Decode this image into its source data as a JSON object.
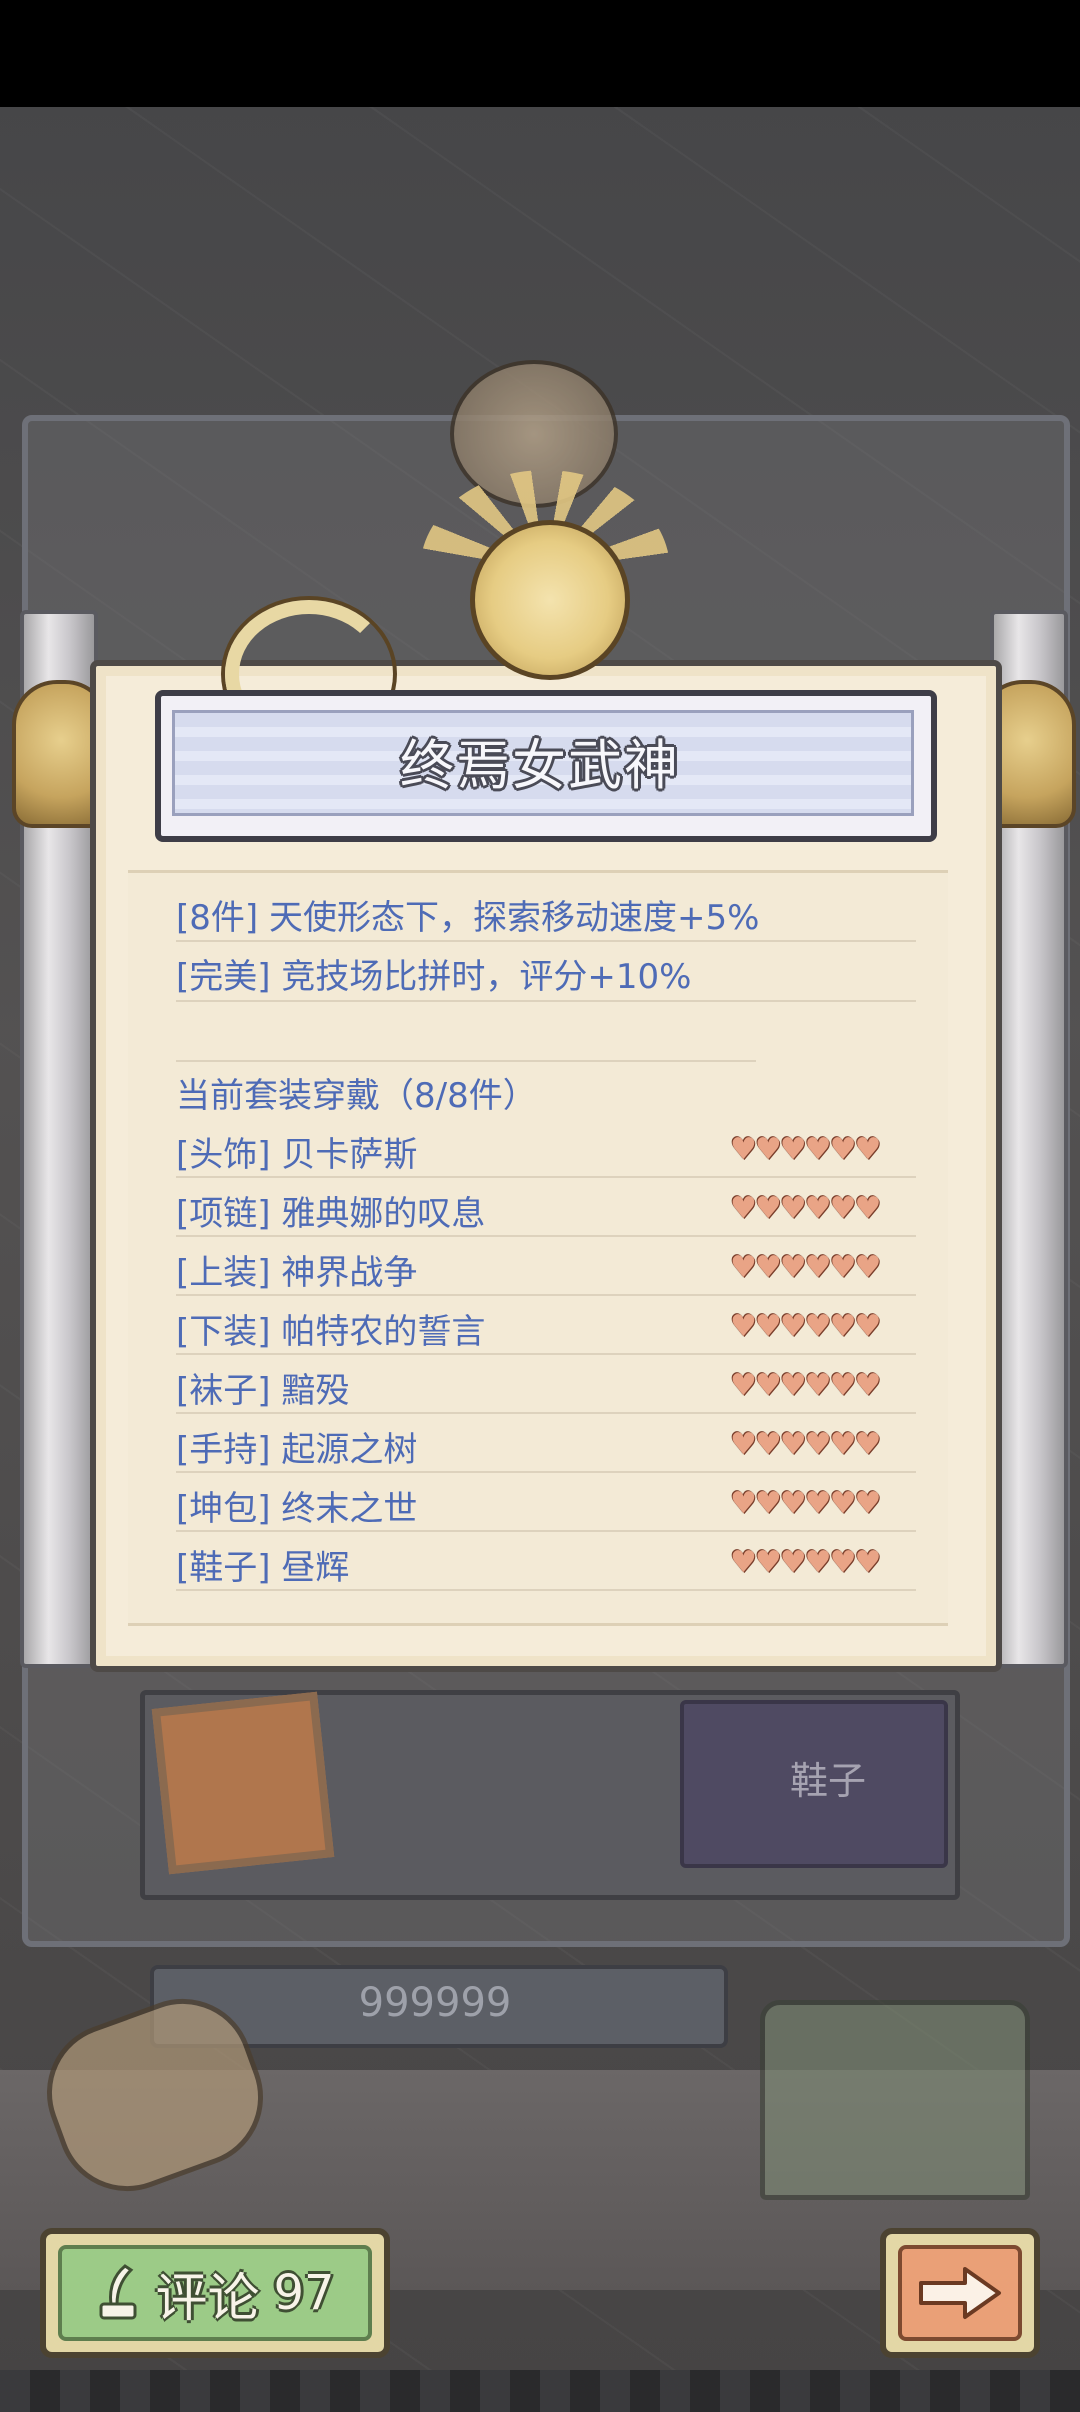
{
  "title": "终焉女武神",
  "bonuses": [
    {
      "label": "[8件]  天使形态下，探索移动速度+5%"
    },
    {
      "label": "[完美] 竞技场比拼时，评分+10%"
    }
  ],
  "set_header": "当前套装穿戴（8/8件）",
  "items": [
    {
      "label": "[头饰] 贝卡萨斯",
      "hearts": 6
    },
    {
      "label": "[项链] 雅典娜的叹息",
      "hearts": 6
    },
    {
      "label": "[上装] 神界战争",
      "hearts": 6
    },
    {
      "label": "[下装] 帕特农的誓言",
      "hearts": 6
    },
    {
      "label": "[袜子] 黯殁",
      "hearts": 6
    },
    {
      "label": "[手持] 起源之树",
      "hearts": 6
    },
    {
      "label": "[坤包] 终末之世",
      "hearts": 6
    },
    {
      "label": "[鞋子] 昼辉",
      "hearts": 6
    }
  ],
  "hearts_text": "♥♥♥♥♥♥",
  "slot_label": "鞋子",
  "counter_value": "999999",
  "comment": {
    "label": "评论",
    "count": "97"
  },
  "colors": {
    "text_blue": "#4e6bb6",
    "heart": "#e9a486",
    "comment_green": "#9ccb87",
    "next_orange": "#eaa077"
  }
}
